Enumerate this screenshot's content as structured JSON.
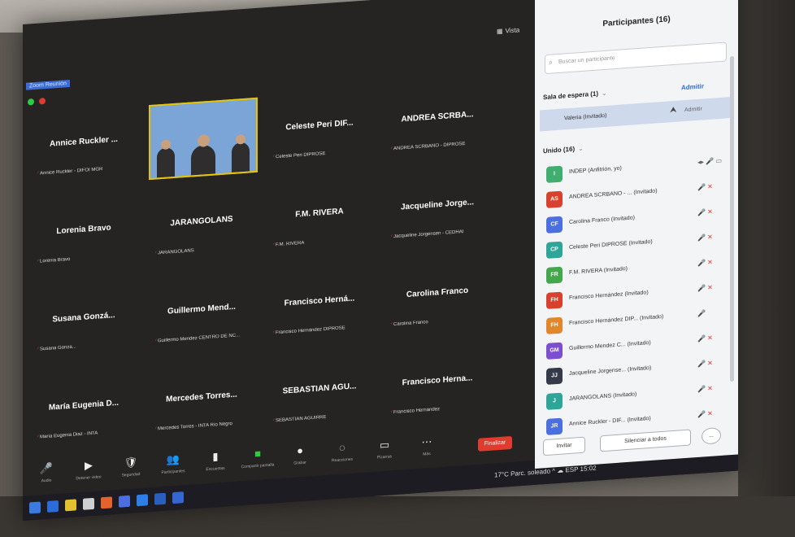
{
  "window": {
    "title": "Zoom Reunión",
    "view_label": "Vista"
  },
  "tiles": [
    {
      "name": "Annice Ruckler ...",
      "label": "Annice Ruckler - DIFOI MGR",
      "video": false
    },
    {
      "name": "",
      "label": "",
      "video": true
    },
    {
      "name": "Celeste Peri DIF...",
      "label": "Celeste Peri DIPROSE",
      "video": false
    },
    {
      "name": "ANDREA SCRBA...",
      "label": "ANDREA SCRBANO - DIPROSE",
      "video": false
    },
    {
      "name": "Lorenia Bravo",
      "label": "Lorenia Bravo",
      "video": false
    },
    {
      "name": "JARANGOLANS",
      "label": "JARANGOLANS",
      "video": false
    },
    {
      "name": "F.M. RIVERA",
      "label": "F.M. RIVERA",
      "video": false
    },
    {
      "name": "Jacqueline Jorge...",
      "label": "Jacqueline Jorgensen - CEDHAI",
      "video": false
    },
    {
      "name": "Susana Gonzá...",
      "label": "Susana Gonza...",
      "video": false
    },
    {
      "name": "Guillermo Mend...",
      "label": "Guillermo Mendez CENTRO DE NC...",
      "video": false
    },
    {
      "name": "Francisco Herná...",
      "label": "Francisco Hernández DIPROSE",
      "video": false
    },
    {
      "name": "Carolina Franco",
      "label": "Carolina Franco",
      "video": false
    },
    {
      "name": "María Eugenia D...",
      "label": "María Eugenia Diaz - INTA",
      "video": false
    },
    {
      "name": "Mercedes Torres...",
      "label": "Mercedes Torres - INTA Río Negro",
      "video": false
    },
    {
      "name": "SEBASTIAN AGU...",
      "label": "SEBASTIAN AGUIRRE",
      "video": false
    },
    {
      "name": "Francisco Herna...",
      "label": "Francisco Hernández",
      "video": false
    }
  ],
  "toolbar": [
    {
      "icon": "🎤",
      "label": "Audio",
      "green": false
    },
    {
      "icon": "▶",
      "label": "Detener video",
      "green": false
    },
    {
      "icon": "🛡",
      "label": "Seguridad",
      "green": false
    },
    {
      "icon": "👥",
      "label": "Participantes",
      "green": false
    },
    {
      "icon": "▮",
      "label": "Encuestas",
      "green": false
    },
    {
      "icon": "■",
      "label": "Compartir pantalla",
      "green": true
    },
    {
      "icon": "●",
      "label": "Grabar",
      "green": false
    },
    {
      "icon": "◌",
      "label": "Reacciones",
      "green": false
    },
    {
      "icon": "▭",
      "label": "Pizarras",
      "green": false
    },
    {
      "icon": "⋯",
      "label": "Más",
      "green": false
    }
  ],
  "end_label": "Finalizar",
  "participants": {
    "title": "Participantes (16)",
    "search_placeholder": "Buscar un participante",
    "waiting": {
      "heading": "Sala de espera (1)",
      "admit_all": "Admitir",
      "row_name": "Valeria (Invitado)",
      "row_action": "Admitir"
    },
    "joined_heading": "Unido (16)",
    "rows": [
      {
        "initials": "I",
        "color": "#3fae6f",
        "name": "INDEP (Anfitrión, yo)",
        "icons": "◂▸ 🎤 ▭",
        "gray": true
      },
      {
        "initials": "AS",
        "color": "#d9412f",
        "name": "ANDREA SCRBANO - ... (Invitado)",
        "icons": "🎤 ✕",
        "gray": false
      },
      {
        "initials": "CF",
        "color": "#4b6fe0",
        "name": "Carolina Franco (Invitado)",
        "icons": "🎤 ✕",
        "gray": false
      },
      {
        "initials": "CP",
        "color": "#2fa59a",
        "name": "Celeste Peri DIPROSE (Invitado)",
        "icons": "🎤 ✕",
        "gray": false
      },
      {
        "initials": "FR",
        "color": "#43a74b",
        "name": "F.M. RIVERA (Invitado)",
        "icons": "🎤 ✕",
        "gray": false
      },
      {
        "initials": "FH",
        "color": "#d9412f",
        "name": "Francisco Hernández (Invitado)",
        "icons": "🎤 ✕",
        "gray": false
      },
      {
        "initials": "FH",
        "color": "#e1862b",
        "name": "Francisco Hernández DIP... (Invitado)",
        "icons": "🎤",
        "gray": false
      },
      {
        "initials": "GM",
        "color": "#7b4fcf",
        "name": "Guillermo Mendez C... (Invitado)",
        "icons": "🎤 ✕",
        "gray": false
      },
      {
        "initials": "JJ",
        "color": "#343a48",
        "name": "Jacqueline Jorgense... (Invitado)",
        "icons": "🎤 ✕",
        "gray": false
      },
      {
        "initials": "J",
        "color": "#2fa59a",
        "name": "JARANGOLANS (Invitado)",
        "icons": "🎤 ✕",
        "gray": false
      },
      {
        "initials": "JR",
        "color": "#4b6fe0",
        "name": "Annice Ruckler - DIF... (Invitado)",
        "icons": "🎤 ✕",
        "gray": false
      }
    ],
    "invite_label": "Invitar",
    "mute_all_label": "Silenciar a todos",
    "more_label": "..."
  },
  "taskbar": {
    "tray_text": "17°C Parc. soleado  ^  ☁  ESP  15:02"
  }
}
